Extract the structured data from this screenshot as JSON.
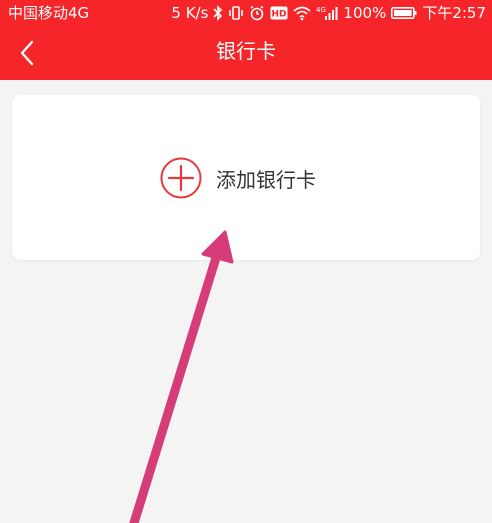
{
  "status_bar": {
    "carrier": "中国移动4G",
    "speed": "5 K/s",
    "hd_badge": "HD",
    "network_type": "4G",
    "battery_percent": "100%",
    "time": "下午2:57",
    "icons": [
      "bluetooth-icon",
      "vibrate-icon",
      "alarm-icon",
      "hd-icon",
      "wifi-icon",
      "signal-icon",
      "battery-icon"
    ]
  },
  "nav": {
    "title": "银行卡",
    "back_icon": "chevron-left-icon"
  },
  "card": {
    "add_label": "添加银行卡",
    "icon": "plus-circle-icon"
  },
  "colors": {
    "header": "#f5252a",
    "accent": "#e8383d",
    "background": "#f4f4f4",
    "arrow": "#d63c78"
  }
}
